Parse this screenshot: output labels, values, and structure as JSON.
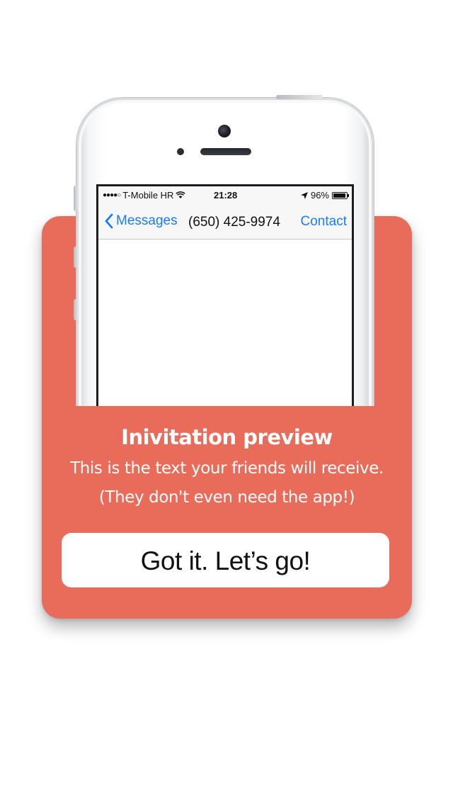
{
  "colors": {
    "card": "#e96b5a",
    "ios_blue": "#1a7cf5",
    "button_bg": "#ffffff"
  },
  "phone": {
    "status_bar": {
      "signal": "●●●●○",
      "carrier": "T-Mobile HR",
      "wifi_icon": "wifi-icon",
      "time": "21:28",
      "location_icon": "location-arrow-icon",
      "battery_percent": "96%",
      "battery_level": 0.96
    },
    "nav": {
      "back_icon": "chevron-left-icon",
      "back_label": "Messages",
      "title": "(650) 425-9974",
      "action_label": "Contact"
    }
  },
  "card": {
    "title": "Inivitation preview",
    "line1": "This is the text your friends will receive.",
    "line2": "(They don't even need the app!)",
    "button_label": "Got it. Let’s go!"
  }
}
